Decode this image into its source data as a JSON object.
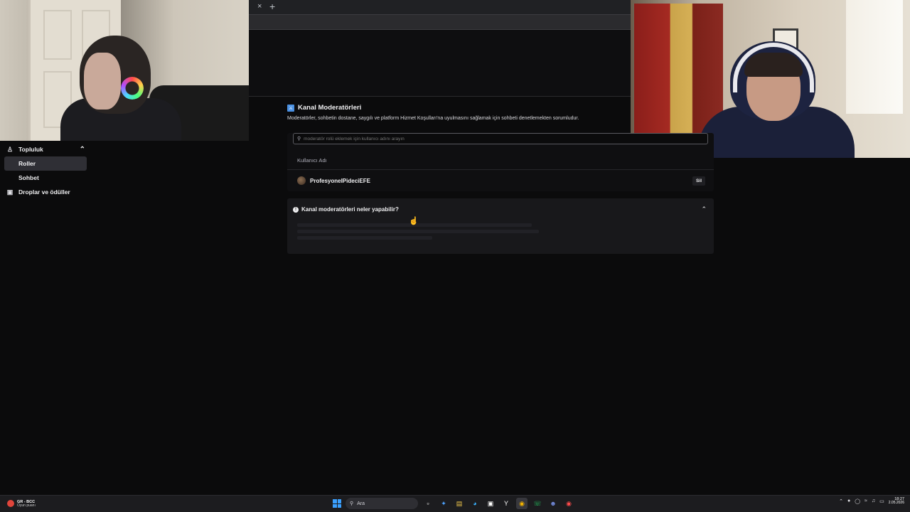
{
  "browser": {
    "tab_close": "×",
    "new_tab": "+"
  },
  "sidebar": {
    "section_label": "Topluluk",
    "items": [
      {
        "label": "Roller",
        "active": true
      },
      {
        "label": "Sohbet",
        "active": false
      }
    ],
    "drops_label": "Droplar ve ödüller"
  },
  "main": {
    "title": "Kanal Moderatörleri",
    "description": "Moderatörler, sohbetin dostane, saygılı ve platform Hizmet Koşulları'na uyulmasını sağlamak için sohbeti denetlemekten sorumludur.",
    "search_placeholder": "moderatör rolü eklemek için kullanıcı adını arayın",
    "column_header": "Kullanıcı Adı",
    "moderators": [
      {
        "username": "ProfesyonelPideciEFE",
        "action_label": "Sil"
      }
    ],
    "faq_question": "Kanal moderatörleri neler yapabilir?"
  },
  "taskbar": {
    "weather_line1": "GR - BCC",
    "weather_line2": "Oyun puanı",
    "search_label": "Ara",
    "time": "18:27",
    "date": "2.05.2026"
  },
  "colors": {
    "accent": "#4a90e2",
    "background": "#0b0b0c",
    "card": "#18181b"
  }
}
